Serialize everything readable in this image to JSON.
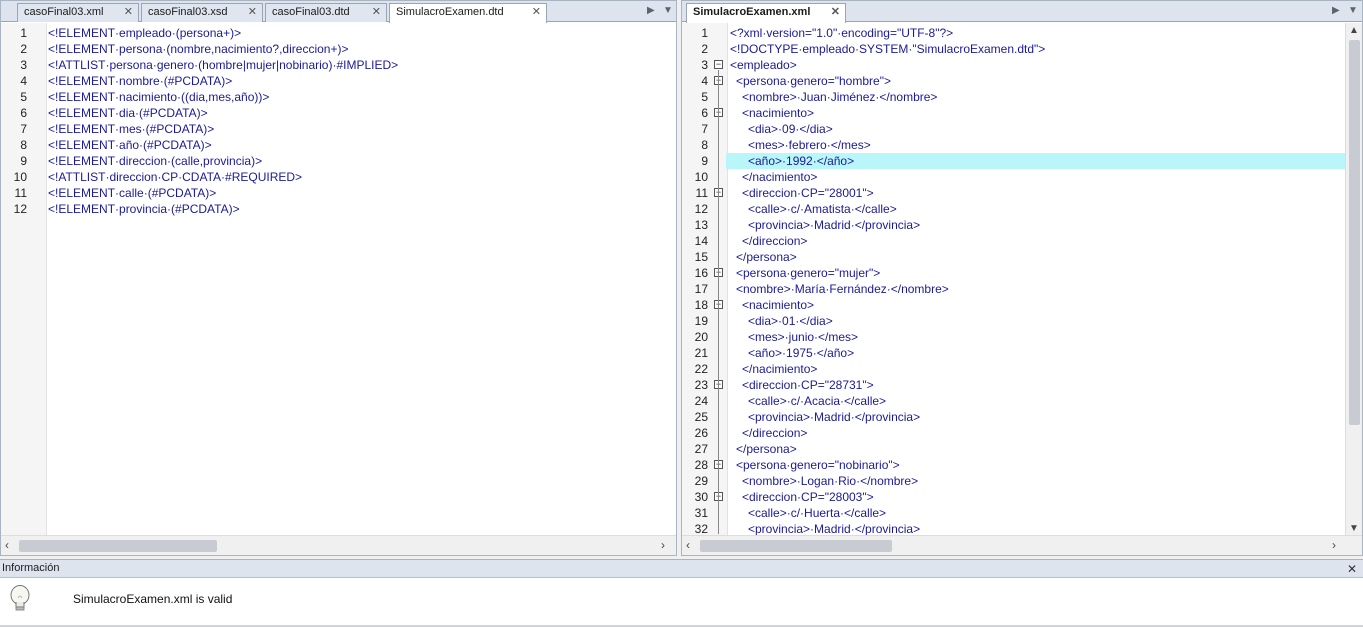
{
  "left_tabs": [
    {
      "label": "casoFinal03.xml"
    },
    {
      "label": "casoFinal03.xsd"
    },
    {
      "label": "casoFinal03.dtd"
    },
    {
      "label": "SimulacroExamen.dtd"
    }
  ],
  "right_tabs": [
    {
      "label": "SimulacroExamen.xml"
    }
  ],
  "left_lines": [
    {
      "n": "1",
      "text": "<!ELEMENT·empleado·(persona+)>"
    },
    {
      "n": "2",
      "text": "<!ELEMENT·persona·(nombre,nacimiento?,direccion+)>"
    },
    {
      "n": "3",
      "text": "<!ATTLIST·persona·genero·(hombre|mujer|nobinario)·#IMPLIED>"
    },
    {
      "n": "4",
      "text": "<!ELEMENT·nombre·(#PCDATA)>"
    },
    {
      "n": "5",
      "text": "<!ELEMENT·nacimiento·((dia,mes,año))>"
    },
    {
      "n": "6",
      "text": "<!ELEMENT·dia·(#PCDATA)>"
    },
    {
      "n": "7",
      "text": "<!ELEMENT·mes·(#PCDATA)>"
    },
    {
      "n": "8",
      "text": "<!ELEMENT·año·(#PCDATA)>"
    },
    {
      "n": "9",
      "text": "<!ELEMENT·direccion·(calle,provincia)>"
    },
    {
      "n": "10",
      "text": "<!ATTLIST·direccion·CP·CDATA·#REQUIRED>"
    },
    {
      "n": "11",
      "text": "<!ELEMENT·calle·(#PCDATA)>"
    },
    {
      "n": "12",
      "text": "<!ELEMENT·provincia·(#PCDATA)>"
    }
  ],
  "right_lines": [
    {
      "n": "1",
      "text": "<?xml·version=\"1.0\"·encoding=\"UTF-8\"?>"
    },
    {
      "n": "2",
      "text": "<!DOCTYPE·empleado·SYSTEM·\"SimulacroExamen.dtd\">"
    },
    {
      "n": "3",
      "text": "<empleado>"
    },
    {
      "n": "4",
      "text": "<persona·genero=\"hombre\">"
    },
    {
      "n": "5",
      "text": "<nombre>·Juan·Jiménez·</nombre>"
    },
    {
      "n": "6",
      "text": "<nacimiento>"
    },
    {
      "n": "7",
      "text": "<dia>·09·</dia>"
    },
    {
      "n": "8",
      "text": "<mes>·febrero·</mes>"
    },
    {
      "n": "9",
      "text": "<año>·1992·</año>"
    },
    {
      "n": "10",
      "text": "</nacimiento>"
    },
    {
      "n": "11",
      "text": "<direccion·CP=\"28001\">"
    },
    {
      "n": "12",
      "text": "<calle>·c/·Amatista·</calle>"
    },
    {
      "n": "13",
      "text": "<provincia>·Madrid·</provincia>"
    },
    {
      "n": "14",
      "text": "</direccion>"
    },
    {
      "n": "15",
      "text": "</persona>"
    },
    {
      "n": "16",
      "text": "<persona·genero=\"mujer\">"
    },
    {
      "n": "17",
      "text": "<nombre>·María·Fernández·</nombre>"
    },
    {
      "n": "18",
      "text": "<nacimiento>"
    },
    {
      "n": "19",
      "text": "<dia>·01·</dia>"
    },
    {
      "n": "20",
      "text": "<mes>·junio·</mes>"
    },
    {
      "n": "21",
      "text": "<año>·1975·</año>"
    },
    {
      "n": "22",
      "text": "</nacimiento>"
    },
    {
      "n": "23",
      "text": "<direccion·CP=\"28731\">"
    },
    {
      "n": "24",
      "text": "<calle>·c/·Acacia·</calle>"
    },
    {
      "n": "25",
      "text": "<provincia>·Madrid·</provincia>"
    },
    {
      "n": "26",
      "text": "</direccion>"
    },
    {
      "n": "27",
      "text": "</persona>"
    },
    {
      "n": "28",
      "text": "<persona·genero=\"nobinario\">"
    },
    {
      "n": "29",
      "text": "<nombre>·Logan·Rio·</nombre>"
    },
    {
      "n": "30",
      "text": "<direccion·CP=\"28003\">"
    },
    {
      "n": "31",
      "text": "<calle>·c/·Huerta·</calle>"
    },
    {
      "n": "32",
      "text": "<provincia>·Madrid·</provincia>"
    }
  ],
  "info": {
    "title": "Información",
    "message": "SimulacroExamen.xml is valid"
  },
  "icons": {
    "tab_close": "close-icon",
    "tab_nav_right": "triangle-right-icon",
    "tab_nav_down": "triangle-down-icon",
    "scroll_left": "chevron-left-icon",
    "scroll_right": "chevron-right-icon",
    "scroll_up": "chevron-up-icon",
    "scroll_down": "chevron-down-icon",
    "info": "lightbulb-icon"
  },
  "colors": {
    "highlight_line": "#b8f6fa",
    "tag": "#0000cc",
    "attribute": "#cc0000"
  }
}
